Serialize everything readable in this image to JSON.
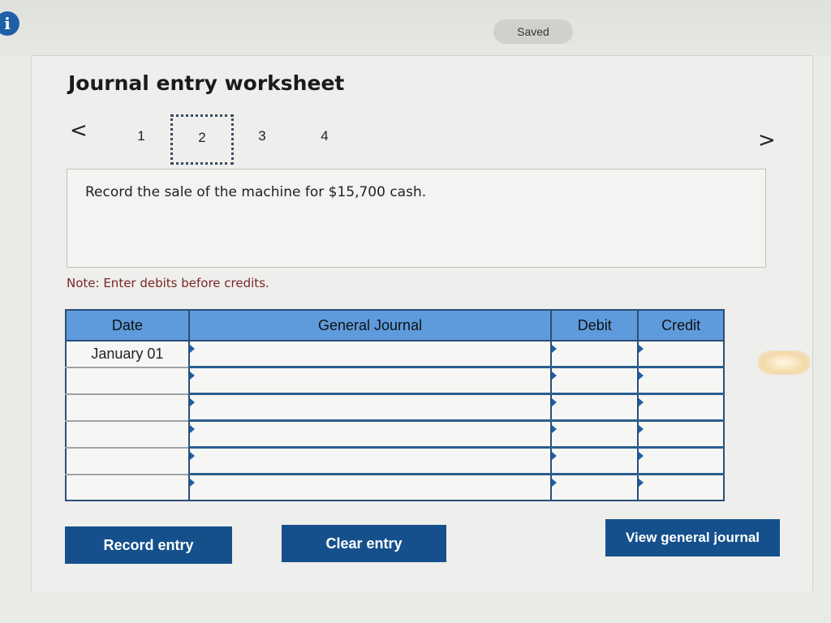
{
  "header": {
    "info_icon": "i",
    "saved_label": "Saved"
  },
  "worksheet": {
    "title": "Journal entry worksheet",
    "nav": {
      "prev": "<",
      "next": ">",
      "steps": [
        "1",
        "2",
        "3",
        "4"
      ],
      "current_step": "2"
    },
    "prompt": "Record the sale of the machine for $15,700 cash.",
    "note": "Note: Enter debits before credits."
  },
  "journal": {
    "headers": {
      "date": "Date",
      "general_journal": "General Journal",
      "debit": "Debit",
      "credit": "Credit"
    },
    "rows": [
      {
        "date": "January 01",
        "account": "",
        "debit": "",
        "credit": ""
      },
      {
        "date": "",
        "account": "",
        "debit": "",
        "credit": ""
      },
      {
        "date": "",
        "account": "",
        "debit": "",
        "credit": ""
      },
      {
        "date": "",
        "account": "",
        "debit": "",
        "credit": ""
      },
      {
        "date": "",
        "account": "",
        "debit": "",
        "credit": ""
      },
      {
        "date": "",
        "account": "",
        "debit": "",
        "credit": ""
      }
    ]
  },
  "buttons": {
    "record": "Record entry",
    "clear": "Clear entry",
    "view": "View general journal"
  },
  "colors": {
    "header_blue": "#5e9bdc",
    "button_blue": "#15508c",
    "note_red": "#7a2626"
  }
}
